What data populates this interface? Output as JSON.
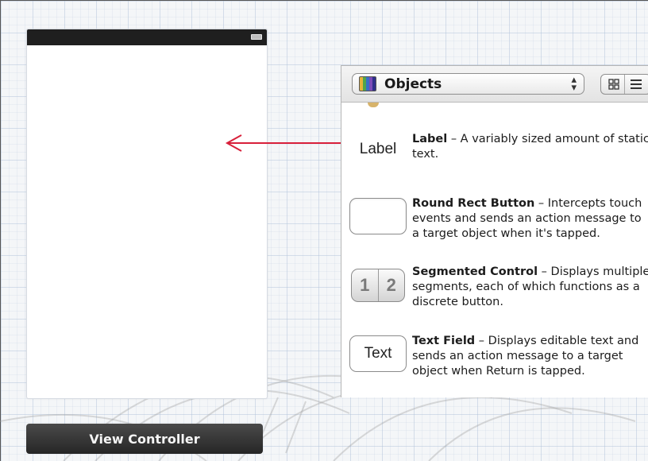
{
  "canvas": {
    "scene": {
      "bottom_bar_label": "View Controller"
    }
  },
  "object_library": {
    "selector_label": "Objects",
    "items": [
      {
        "icon": "label-icon",
        "icon_text": "Label",
        "title": "Label",
        "description": " – A variably sized amount of static text."
      },
      {
        "icon": "round-rect-button-icon",
        "icon_text": "",
        "title": "Round Rect Button",
        "description": " – Intercepts touch events and sends an action message to a target object when it's tapped."
      },
      {
        "icon": "segmented-control-icon",
        "icon_text": [
          "1",
          "2"
        ],
        "title": "Segmented Control",
        "description": " – Displays multiple segments, each of which functions as a discrete button."
      },
      {
        "icon": "text-field-icon",
        "icon_text": "Text",
        "title": "Text Field",
        "description": " – Displays editable text and sends an action message to a target object when Return is tapped."
      }
    ]
  },
  "colors": {
    "arrow": "#d8203a",
    "scene_bar": "#2e2e2e",
    "grid": "#aabed7"
  }
}
